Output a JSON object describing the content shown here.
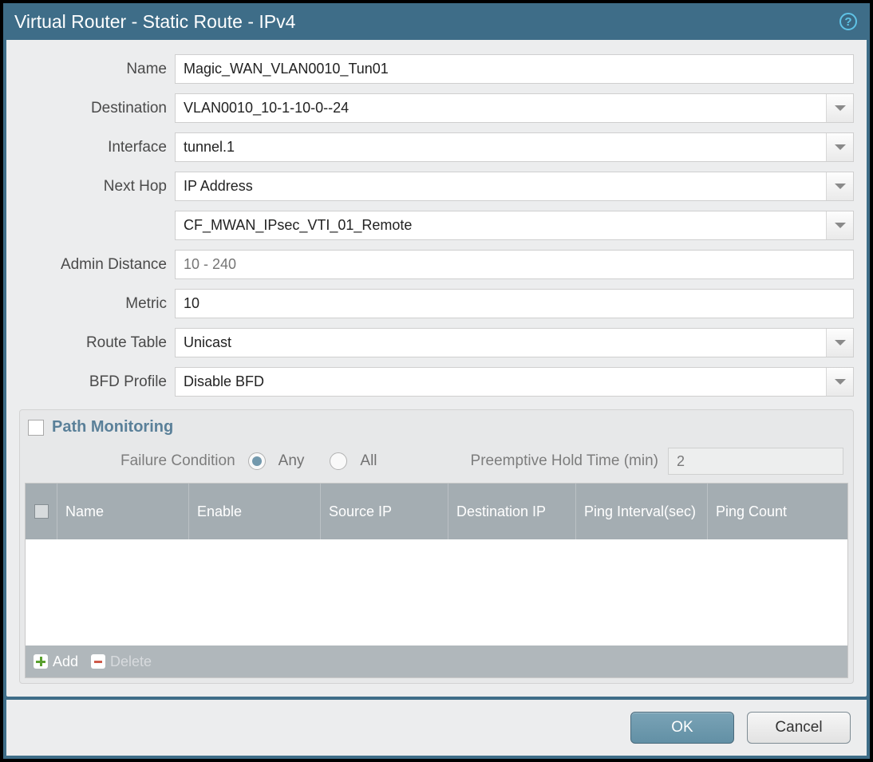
{
  "title": "Virtual Router - Static Route - IPv4",
  "labels": {
    "name": "Name",
    "destination": "Destination",
    "interface": "Interface",
    "nextHop": "Next Hop",
    "adminDistance": "Admin Distance",
    "metric": "Metric",
    "routeTable": "Route Table",
    "bfdProfile": "BFD Profile"
  },
  "values": {
    "name": "Magic_WAN_VLAN0010_Tun01",
    "destination": "VLAN0010_10-1-10-0--24",
    "interface": "tunnel.1",
    "nextHopType": "IP Address",
    "nextHopValue": "CF_MWAN_IPsec_VTI_01_Remote",
    "adminDistance": "",
    "metric": "10",
    "routeTable": "Unicast",
    "bfdProfile": "Disable BFD"
  },
  "placeholders": {
    "adminDistance": "10 - 240"
  },
  "pathMonitoring": {
    "title": "Path Monitoring",
    "enabled": false,
    "failureConditionLabel": "Failure Condition",
    "failureCondition": "Any",
    "optionAny": "Any",
    "optionAll": "All",
    "holdTimeLabel": "Preemptive Hold Time (min)",
    "holdTime": "2"
  },
  "table": {
    "columns": {
      "name": "Name",
      "enable": "Enable",
      "sourceIp": "Source IP",
      "destIp": "Destination IP",
      "pingInterval": "Ping Interval(sec)",
      "pingCount": "Ping Count"
    },
    "rows": []
  },
  "tableFooter": {
    "add": "Add",
    "delete": "Delete"
  },
  "footer": {
    "ok": "OK",
    "cancel": "Cancel"
  }
}
